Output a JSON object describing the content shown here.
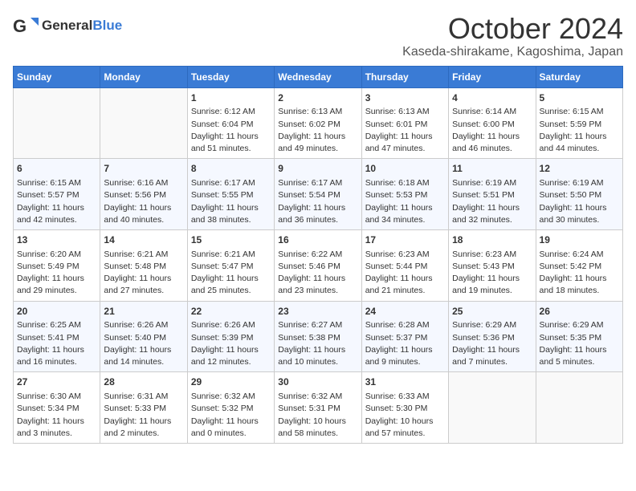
{
  "logo": {
    "text_general": "General",
    "text_blue": "Blue",
    "icon_color": "#3a7bd5"
  },
  "header": {
    "title": "October 2024",
    "subtitle": "Kaseda-shirakame, Kagoshima, Japan"
  },
  "weekdays": [
    "Sunday",
    "Monday",
    "Tuesday",
    "Wednesday",
    "Thursday",
    "Friday",
    "Saturday"
  ],
  "weeks": [
    [
      {
        "day": "",
        "content": ""
      },
      {
        "day": "",
        "content": ""
      },
      {
        "day": "1",
        "content": "Sunrise: 6:12 AM\nSunset: 6:04 PM\nDaylight: 11 hours and 51 minutes."
      },
      {
        "day": "2",
        "content": "Sunrise: 6:13 AM\nSunset: 6:02 PM\nDaylight: 11 hours and 49 minutes."
      },
      {
        "day": "3",
        "content": "Sunrise: 6:13 AM\nSunset: 6:01 PM\nDaylight: 11 hours and 47 minutes."
      },
      {
        "day": "4",
        "content": "Sunrise: 6:14 AM\nSunset: 6:00 PM\nDaylight: 11 hours and 46 minutes."
      },
      {
        "day": "5",
        "content": "Sunrise: 6:15 AM\nSunset: 5:59 PM\nDaylight: 11 hours and 44 minutes."
      }
    ],
    [
      {
        "day": "6",
        "content": "Sunrise: 6:15 AM\nSunset: 5:57 PM\nDaylight: 11 hours and 42 minutes."
      },
      {
        "day": "7",
        "content": "Sunrise: 6:16 AM\nSunset: 5:56 PM\nDaylight: 11 hours and 40 minutes."
      },
      {
        "day": "8",
        "content": "Sunrise: 6:17 AM\nSunset: 5:55 PM\nDaylight: 11 hours and 38 minutes."
      },
      {
        "day": "9",
        "content": "Sunrise: 6:17 AM\nSunset: 5:54 PM\nDaylight: 11 hours and 36 minutes."
      },
      {
        "day": "10",
        "content": "Sunrise: 6:18 AM\nSunset: 5:53 PM\nDaylight: 11 hours and 34 minutes."
      },
      {
        "day": "11",
        "content": "Sunrise: 6:19 AM\nSunset: 5:51 PM\nDaylight: 11 hours and 32 minutes."
      },
      {
        "day": "12",
        "content": "Sunrise: 6:19 AM\nSunset: 5:50 PM\nDaylight: 11 hours and 30 minutes."
      }
    ],
    [
      {
        "day": "13",
        "content": "Sunrise: 6:20 AM\nSunset: 5:49 PM\nDaylight: 11 hours and 29 minutes."
      },
      {
        "day": "14",
        "content": "Sunrise: 6:21 AM\nSunset: 5:48 PM\nDaylight: 11 hours and 27 minutes."
      },
      {
        "day": "15",
        "content": "Sunrise: 6:21 AM\nSunset: 5:47 PM\nDaylight: 11 hours and 25 minutes."
      },
      {
        "day": "16",
        "content": "Sunrise: 6:22 AM\nSunset: 5:46 PM\nDaylight: 11 hours and 23 minutes."
      },
      {
        "day": "17",
        "content": "Sunrise: 6:23 AM\nSunset: 5:44 PM\nDaylight: 11 hours and 21 minutes."
      },
      {
        "day": "18",
        "content": "Sunrise: 6:23 AM\nSunset: 5:43 PM\nDaylight: 11 hours and 19 minutes."
      },
      {
        "day": "19",
        "content": "Sunrise: 6:24 AM\nSunset: 5:42 PM\nDaylight: 11 hours and 18 minutes."
      }
    ],
    [
      {
        "day": "20",
        "content": "Sunrise: 6:25 AM\nSunset: 5:41 PM\nDaylight: 11 hours and 16 minutes."
      },
      {
        "day": "21",
        "content": "Sunrise: 6:26 AM\nSunset: 5:40 PM\nDaylight: 11 hours and 14 minutes."
      },
      {
        "day": "22",
        "content": "Sunrise: 6:26 AM\nSunset: 5:39 PM\nDaylight: 11 hours and 12 minutes."
      },
      {
        "day": "23",
        "content": "Sunrise: 6:27 AM\nSunset: 5:38 PM\nDaylight: 11 hours and 10 minutes."
      },
      {
        "day": "24",
        "content": "Sunrise: 6:28 AM\nSunset: 5:37 PM\nDaylight: 11 hours and 9 minutes."
      },
      {
        "day": "25",
        "content": "Sunrise: 6:29 AM\nSunset: 5:36 PM\nDaylight: 11 hours and 7 minutes."
      },
      {
        "day": "26",
        "content": "Sunrise: 6:29 AM\nSunset: 5:35 PM\nDaylight: 11 hours and 5 minutes."
      }
    ],
    [
      {
        "day": "27",
        "content": "Sunrise: 6:30 AM\nSunset: 5:34 PM\nDaylight: 11 hours and 3 minutes."
      },
      {
        "day": "28",
        "content": "Sunrise: 6:31 AM\nSunset: 5:33 PM\nDaylight: 11 hours and 2 minutes."
      },
      {
        "day": "29",
        "content": "Sunrise: 6:32 AM\nSunset: 5:32 PM\nDaylight: 11 hours and 0 minutes."
      },
      {
        "day": "30",
        "content": "Sunrise: 6:32 AM\nSunset: 5:31 PM\nDaylight: 10 hours and 58 minutes."
      },
      {
        "day": "31",
        "content": "Sunrise: 6:33 AM\nSunset: 5:30 PM\nDaylight: 10 hours and 57 minutes."
      },
      {
        "day": "",
        "content": ""
      },
      {
        "day": "",
        "content": ""
      }
    ]
  ]
}
